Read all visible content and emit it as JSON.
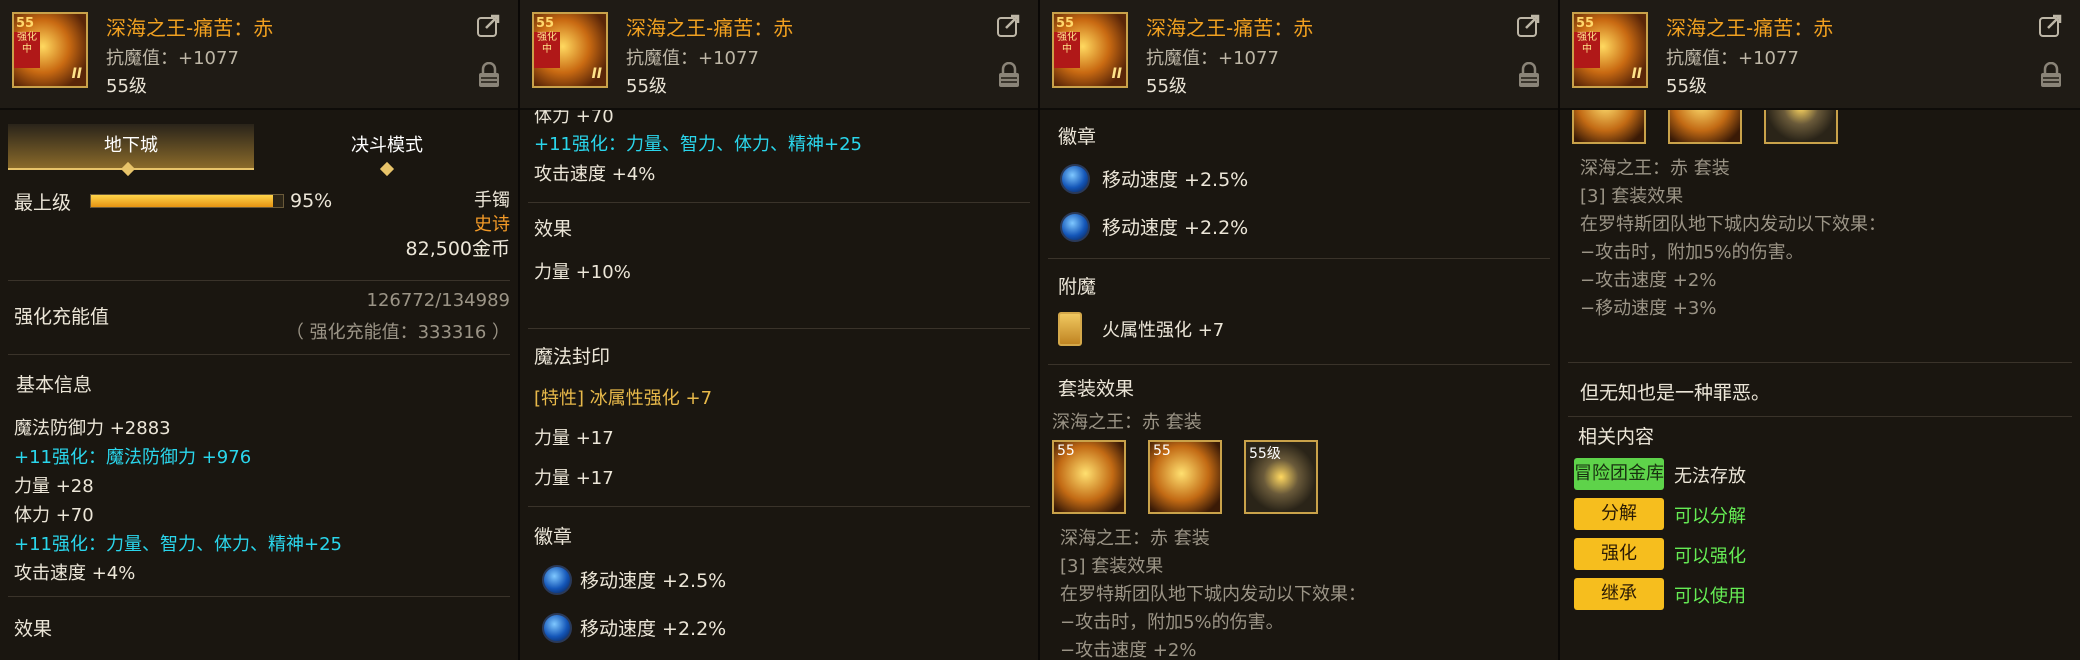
{
  "item": {
    "name": "深海之王-痛苦：赤",
    "stat_line": "抗魔值：+1077",
    "level": "55级",
    "icon_corner": "55",
    "icon_ribbon": "强化中",
    "icon_tier": "II"
  },
  "colors": {
    "title": "#f0a020",
    "cyan": "#2ad6ec",
    "green": "#66ee55",
    "gold_btn": "#f6be1e"
  },
  "panel1": {
    "tabs": [
      "地下城",
      "决斗模式"
    ],
    "grade_label": "最上级",
    "grade_percent": "95%",
    "grade_fraction": 0.95,
    "item_type": "手镯",
    "rarity": "史诗",
    "price": "82,500金币",
    "reinforce_label": "强化充能值",
    "reinforce_value": "126772/134989",
    "reinforce_total": "（ 强化充能值：333316 ）",
    "basic_info_title": "基本信息",
    "lines": [
      {
        "text": "魔法防御力 +2883",
        "color": "white"
      },
      {
        "text": "+11强化：魔法防御力 +976",
        "color": "cyan"
      },
      {
        "text": "力量 +28",
        "color": "white"
      },
      {
        "text": "体力 +70",
        "color": "white"
      },
      {
        "text": "+11强化：力量、智力、体力、精神+25",
        "color": "cyan"
      },
      {
        "text": "攻击速度 +4%",
        "color": "white"
      }
    ],
    "effect_title": "效果"
  },
  "panel2": {
    "partial_top": "体力 +70",
    "reinforce_line": "+11强化：力量、智力、体力、精神+25",
    "attack_speed": "攻击速度 +4%",
    "effect_title": "效果",
    "effect_line": "力量 +10%",
    "seal_title": "魔法封印",
    "seal_trait": "[特性] 冰属性强化 +7",
    "seal_lines": [
      "力量 +17",
      "力量 +17"
    ],
    "emblem_title": "徽章",
    "emblems": [
      "移动速度 +2.5%",
      "移动速度 +2.2%"
    ]
  },
  "panel3": {
    "emblem_title": "徽章",
    "emblems": [
      "移动速度 +2.5%",
      "移动速度 +2.2%"
    ],
    "enchant_title": "附魔",
    "enchant_line": "火属性强化 +7",
    "set_title": "套装效果",
    "set_name": "深海之王：赤 套装",
    "set_item_labels": [
      "55",
      "55",
      "55级"
    ],
    "set_name2": "深海之王：赤 套装",
    "set_bonus_title": "[3] 套装效果",
    "set_bonus_desc": "在罗特斯团队地下城内发动以下效果：",
    "set_bonus_lines": [
      "−攻击时，附加5%的伤害。",
      "−攻击速度 +2%"
    ]
  },
  "panel4": {
    "set_name": "深海之王：赤 套装",
    "set_bonus_title": "[3] 套装效果",
    "set_bonus_desc": "在罗特斯团队地下城内发动以下效果：",
    "set_bonus_lines": [
      "−攻击时，附加5%的伤害。",
      "−攻击速度 +2%",
      "−移动速度 +3%"
    ],
    "flavor": "但无知也是一种罪恶。",
    "related_title": "相关内容",
    "related": [
      {
        "button": "冒险团金库",
        "status": "无法存放",
        "style": "green"
      },
      {
        "button": "分解",
        "status": "可以分解",
        "style": "gold"
      },
      {
        "button": "强化",
        "status": "可以强化",
        "style": "gold"
      },
      {
        "button": "继承",
        "status": "可以使用",
        "style": "gold"
      }
    ]
  }
}
